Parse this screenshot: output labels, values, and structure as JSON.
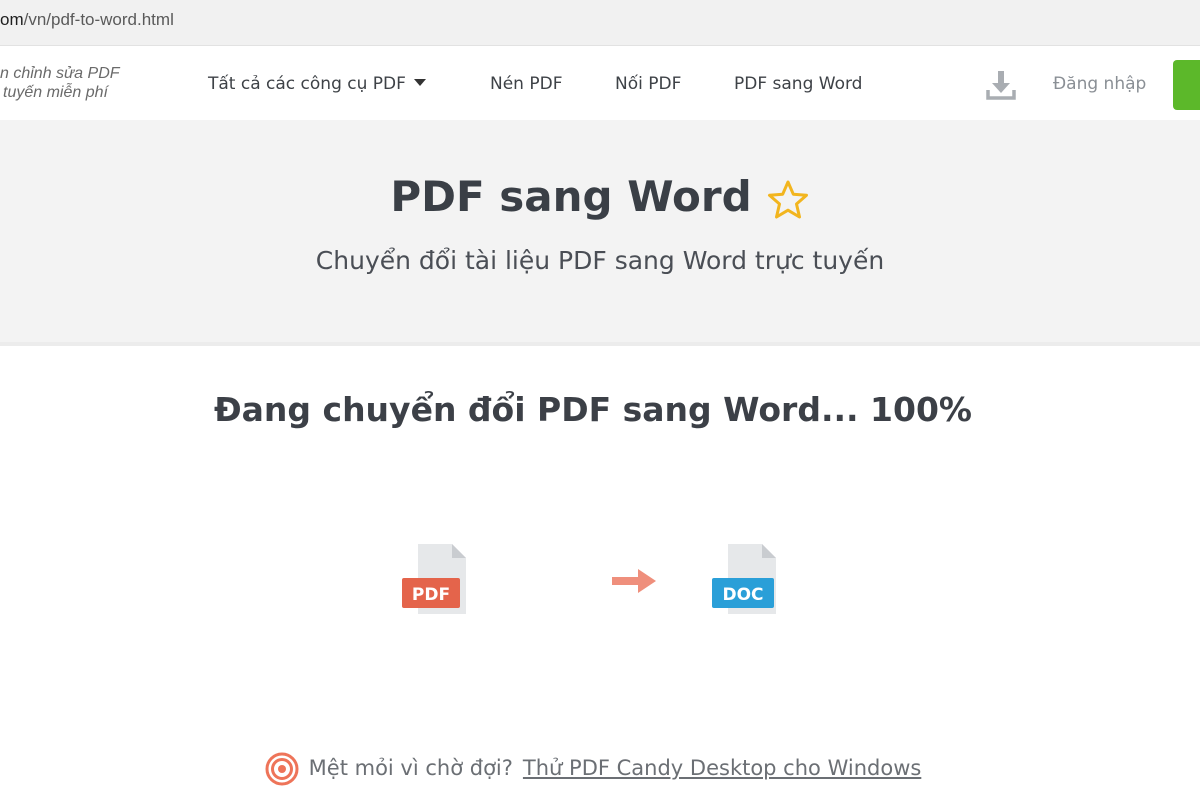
{
  "browser": {
    "url_host": "om",
    "url_path": "/vn/pdf-to-word.html"
  },
  "header": {
    "tagline_line1": "n chỉnh sửa PDF",
    "tagline_line2": "tuyến miễn phí",
    "nav": {
      "all_tools": "Tất cả các công cụ PDF",
      "compress": "Nén PDF",
      "merge": "Nối PDF",
      "pdf_to_word": "PDF sang Word"
    },
    "login": "Đăng nhập"
  },
  "hero": {
    "title": "PDF sang Word",
    "subtitle": "Chuyển đổi tài liệu PDF sang Word trực tuyến"
  },
  "conversion": {
    "status": "Đang chuyển đổi PDF sang Word... 100%",
    "progress_percent": 100,
    "source_label": "PDF",
    "target_label": "DOC"
  },
  "promo": {
    "question": "Mệt mỏi vì chờ đợi?",
    "link": "Thử PDF Candy Desktop cho Windows"
  },
  "colors": {
    "pdf_accent": "#e4644b",
    "doc_accent": "#2a9fd8",
    "arrow": "#ef8f7c",
    "star": "#f2b51e",
    "login_button": "#5cb82a"
  },
  "icons": {
    "download": "download-icon",
    "star": "star-outline-icon",
    "arrow": "arrow-right-icon",
    "swirl": "pdf-candy-swirl-icon"
  }
}
